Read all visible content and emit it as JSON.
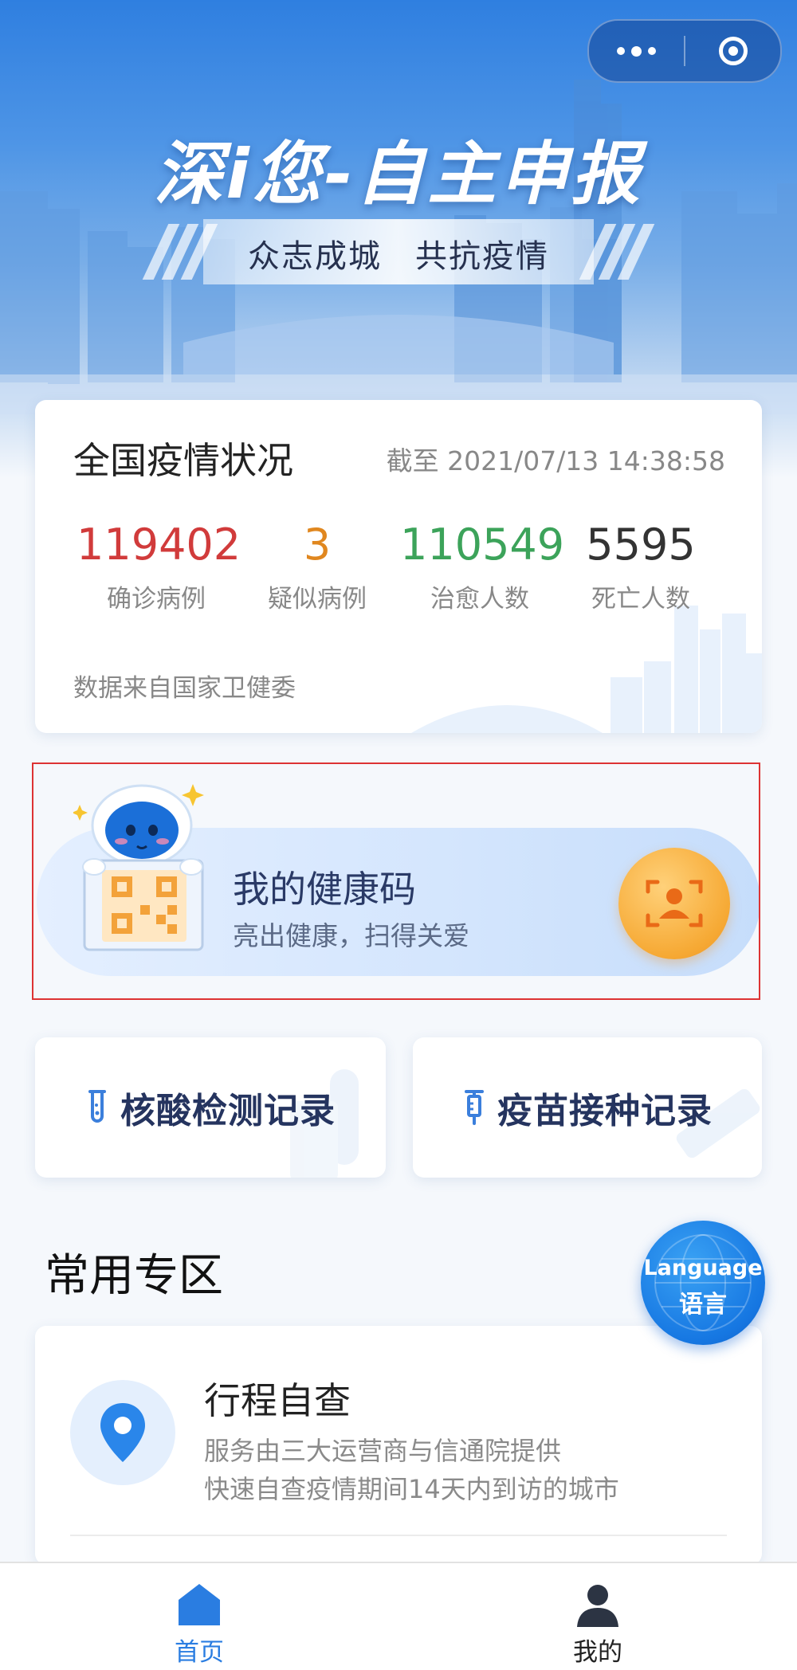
{
  "header": {
    "title": "深i您-自主申报",
    "slogan": "众志成城　共抗疫情"
  },
  "stats": {
    "title": "全国疫情状况",
    "updated": "截至 2021/07/13 14:38:58",
    "items": [
      {
        "value": "119402",
        "label": "确诊病例",
        "color": "#d13b3b"
      },
      {
        "value": "3",
        "label": "疑似病例",
        "color": "#e0871f"
      },
      {
        "value": "110549",
        "label": "治愈人数",
        "color": "#3ca35a"
      },
      {
        "value": "5595",
        "label": "死亡人数",
        "color": "#333333"
      }
    ],
    "source": "数据来自国家卫健委"
  },
  "health_code": {
    "title": "我的健康码",
    "subtitle": "亮出健康，扫得关爱",
    "scan_icon": "face-scan-icon"
  },
  "records": {
    "nucleic": {
      "label": "核酸检测记录",
      "icon": "test-tube-icon"
    },
    "vaccine": {
      "label": "疫苗接种记录",
      "icon": "syringe-icon"
    }
  },
  "common": {
    "title": "常用专区",
    "trip": {
      "title": "行程自查",
      "line1": "服务由三大运营商与信通院提供",
      "line2": "快速自查疫情期间14天内到访的城市",
      "icon": "location-pin-icon"
    }
  },
  "language": {
    "en": "Language",
    "zh": "语言"
  },
  "tabbar": {
    "home": {
      "label": "首页",
      "active": true
    },
    "mine": {
      "label": "我的",
      "active": false
    }
  },
  "colors": {
    "primary": "#1677e2",
    "tab_active": "#2a7de1",
    "accent_orange": "#f6a934"
  }
}
